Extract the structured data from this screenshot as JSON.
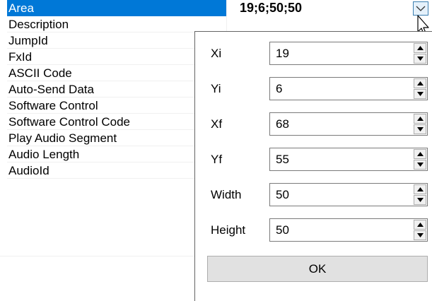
{
  "grid": {
    "rows": [
      {
        "name": "Area"
      },
      {
        "name": "Description"
      },
      {
        "name": "JumpId"
      },
      {
        "name": "FxId"
      },
      {
        "name": "ASCII Code"
      },
      {
        "name": "Auto-Send Data"
      },
      {
        "name": "Software Control"
      },
      {
        "name": "Software Control Code"
      },
      {
        "name": "Play Audio Segment"
      },
      {
        "name": "Audio Length"
      },
      {
        "name": "AudioId"
      }
    ],
    "area_value": "19;6;50;50",
    "dropdown_icon": "chevron-down-icon",
    "selected_row_color": "#0078d7"
  },
  "popup": {
    "fields": [
      {
        "label": "Xi",
        "value": "19"
      },
      {
        "label": "Yi",
        "value": "6"
      },
      {
        "label": "Xf",
        "value": "68"
      },
      {
        "label": "Yf",
        "value": "55"
      },
      {
        "label": "Width",
        "value": "50"
      },
      {
        "label": "Height",
        "value": "50"
      }
    ],
    "ok_label": "OK"
  }
}
